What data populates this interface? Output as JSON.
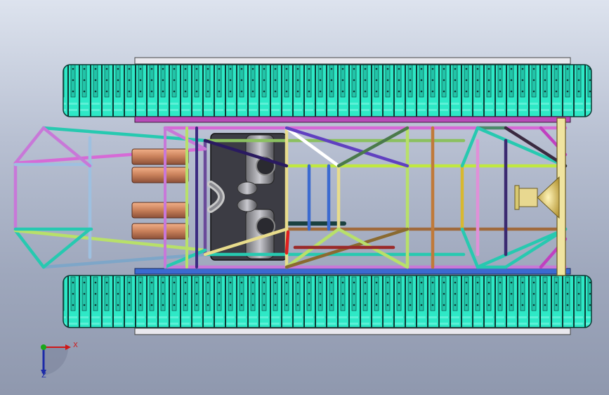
{
  "viewport": {
    "background_top": "#dde3ee",
    "background_bottom": "#8f98ae"
  },
  "model": {
    "track_color": "#2ee8c6",
    "track_outline": "#0b3a34",
    "frame_colors": [
      "#27c9b0",
      "#7ea6c8",
      "#d66ad6",
      "#b8e06a",
      "#a06a3c",
      "#3a2a80",
      "#e8dc8c",
      "#ffffff"
    ]
  },
  "triad": {
    "x_label": "X",
    "z_label": "Z",
    "x_color": "#d01818",
    "y_color": "#18a818",
    "z_color": "#1c2aa8"
  }
}
